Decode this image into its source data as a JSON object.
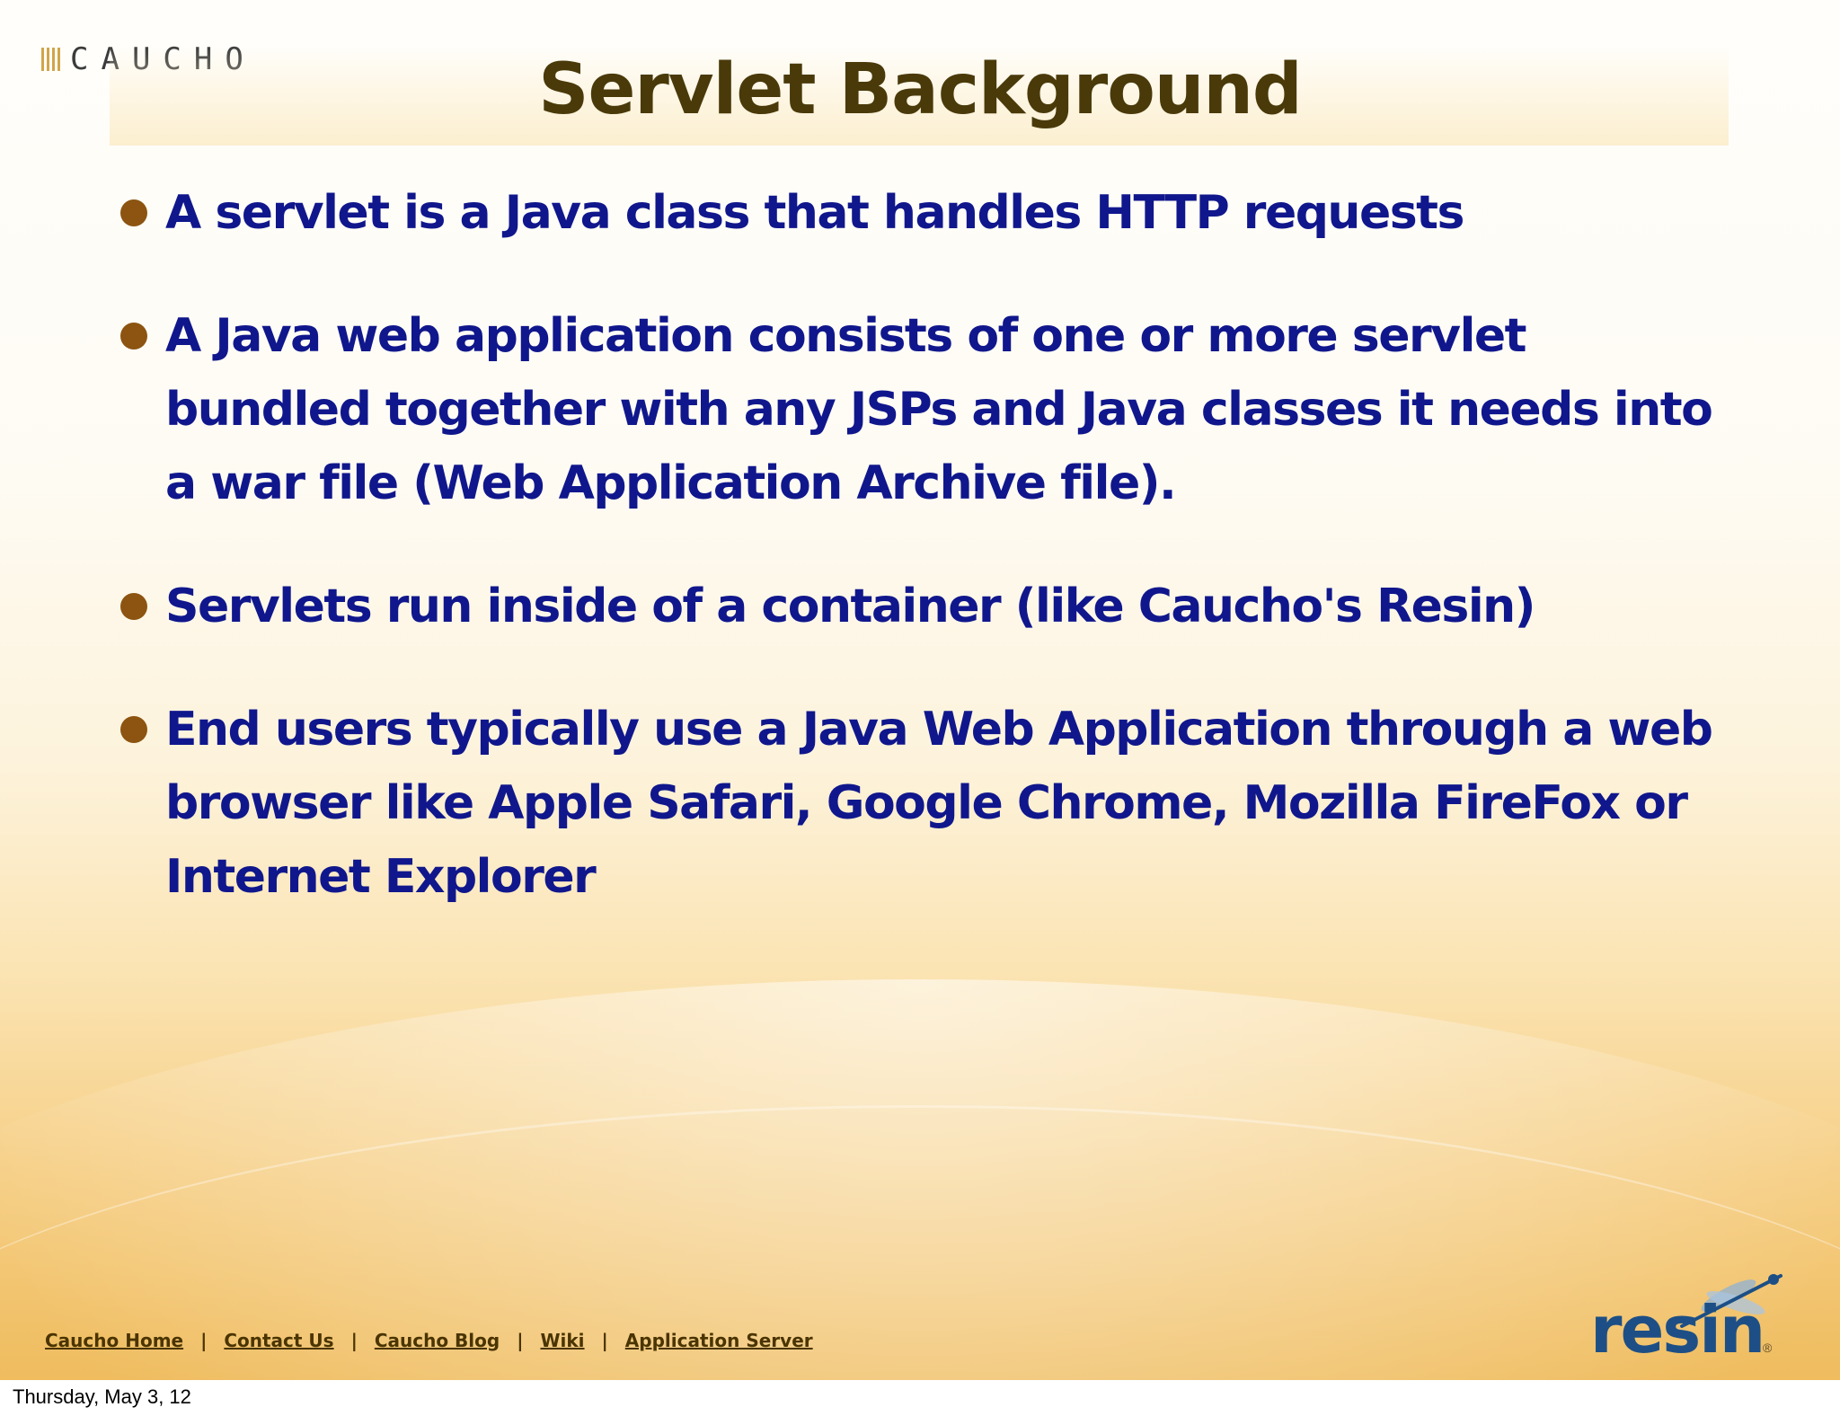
{
  "logo": {
    "caucho_text": "CAUCHO"
  },
  "slide": {
    "title": "Servlet Background",
    "bullets": [
      "A servlet is a Java class that handles HTTP requests",
      "A Java web application consists of one or more servlet bundled together with any JSPs and Java classes it needs into a war file (Web Application Archive file).",
      "Servlets run inside of a container (like Caucho's Resin)",
      "End users typically use a Java Web Application through a web browser like Apple Safari, Google Chrome, Mozilla FireFox or Internet Explorer"
    ]
  },
  "footer": {
    "links": [
      "Caucho Home",
      "Contact Us",
      "Caucho Blog",
      "Wiki",
      "Application Server"
    ],
    "separator": "|",
    "resin_logo_text": "resin",
    "resin_reg": "®"
  },
  "caption": {
    "date": "Thursday, May 3, 12"
  },
  "colors": {
    "title": "#4a3a0a",
    "bullet_text": "#10178c",
    "bullet_dot": "#8c5410",
    "resin_blue": "#1d4f86"
  }
}
